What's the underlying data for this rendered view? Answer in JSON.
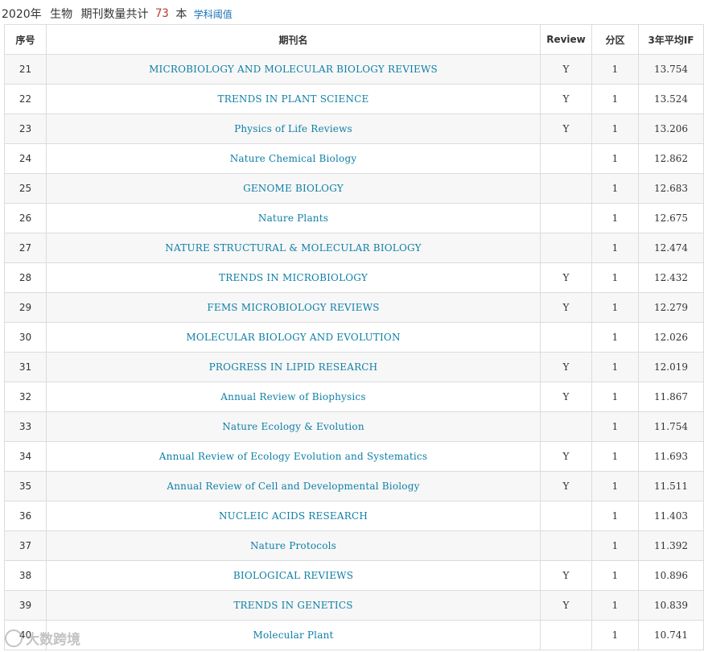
{
  "header": {
    "year_label": "2020年",
    "subject": "生物",
    "count_prefix": "期刊数量共计",
    "count": "73",
    "count_unit": "本",
    "threshold_link": "学科阈值"
  },
  "table": {
    "columns": [
      "序号",
      "期刊名",
      "Review",
      "分区",
      "3年平均IF"
    ],
    "rows": [
      {
        "rank": "21",
        "name": "MICROBIOLOGY AND MOLECULAR BIOLOGY REVIEWS",
        "review": "Y",
        "zone": "1",
        "if": "13.754"
      },
      {
        "rank": "22",
        "name": "TRENDS IN PLANT SCIENCE",
        "review": "Y",
        "zone": "1",
        "if": "13.524"
      },
      {
        "rank": "23",
        "name": "Physics of Life Reviews",
        "review": "Y",
        "zone": "1",
        "if": "13.206"
      },
      {
        "rank": "24",
        "name": "Nature Chemical Biology",
        "review": "",
        "zone": "1",
        "if": "12.862"
      },
      {
        "rank": "25",
        "name": "GENOME BIOLOGY",
        "review": "",
        "zone": "1",
        "if": "12.683"
      },
      {
        "rank": "26",
        "name": "Nature Plants",
        "review": "",
        "zone": "1",
        "if": "12.675"
      },
      {
        "rank": "27",
        "name": "NATURE STRUCTURAL & MOLECULAR BIOLOGY",
        "review": "",
        "zone": "1",
        "if": "12.474"
      },
      {
        "rank": "28",
        "name": "TRENDS IN MICROBIOLOGY",
        "review": "Y",
        "zone": "1",
        "if": "12.432"
      },
      {
        "rank": "29",
        "name": "FEMS MICROBIOLOGY REVIEWS",
        "review": "Y",
        "zone": "1",
        "if": "12.279"
      },
      {
        "rank": "30",
        "name": "MOLECULAR BIOLOGY AND EVOLUTION",
        "review": "",
        "zone": "1",
        "if": "12.026"
      },
      {
        "rank": "31",
        "name": "PROGRESS IN LIPID RESEARCH",
        "review": "Y",
        "zone": "1",
        "if": "12.019"
      },
      {
        "rank": "32",
        "name": "Annual Review of Biophysics",
        "review": "Y",
        "zone": "1",
        "if": "11.867"
      },
      {
        "rank": "33",
        "name": "Nature Ecology & Evolution",
        "review": "",
        "zone": "1",
        "if": "11.754"
      },
      {
        "rank": "34",
        "name": "Annual Review of Ecology Evolution and Systematics",
        "review": "Y",
        "zone": "1",
        "if": "11.693"
      },
      {
        "rank": "35",
        "name": "Annual Review of Cell and Developmental Biology",
        "review": "Y",
        "zone": "1",
        "if": "11.511"
      },
      {
        "rank": "36",
        "name": "NUCLEIC ACIDS RESEARCH",
        "review": "",
        "zone": "1",
        "if": "11.403"
      },
      {
        "rank": "37",
        "name": "Nature Protocols",
        "review": "",
        "zone": "1",
        "if": "11.392"
      },
      {
        "rank": "38",
        "name": "BIOLOGICAL REVIEWS",
        "review": "Y",
        "zone": "1",
        "if": "10.896"
      },
      {
        "rank": "39",
        "name": "TRENDS IN GENETICS",
        "review": "Y",
        "zone": "1",
        "if": "10.839"
      },
      {
        "rank": "40",
        "name": "Molecular Plant",
        "review": "",
        "zone": "1",
        "if": "10.741"
      }
    ]
  },
  "watermark": {
    "text": "大数跨境"
  },
  "colors": {
    "link": "#0e7fa6",
    "count": "#c0392b",
    "border": "#dcdcdc",
    "row_alt": "#f7f7f7"
  }
}
